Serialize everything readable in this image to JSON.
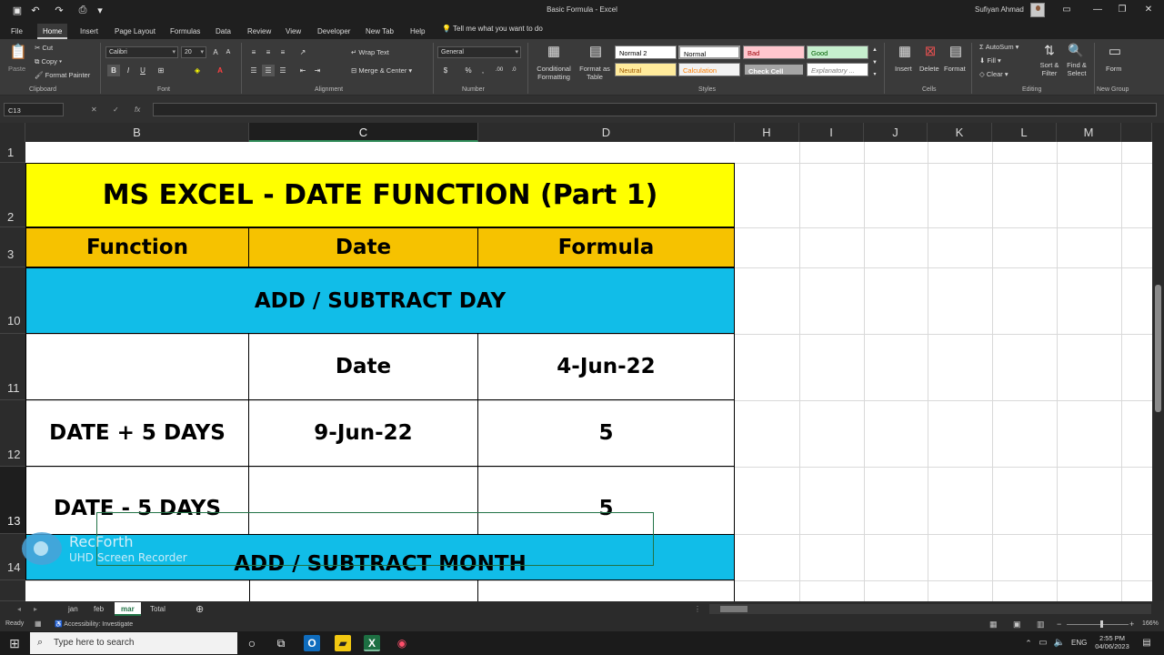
{
  "window": {
    "title": "Basic Formula  -  Excel",
    "user": "Sufiyan Ahmad"
  },
  "ribbon_tabs": [
    "File",
    "Home",
    "Insert",
    "Page Layout",
    "Formulas",
    "Data",
    "Review",
    "Developer",
    "New Tab",
    "Help"
  ],
  "tell_me": "Tell me what you want to do",
  "ribbon": {
    "clipboard": {
      "label": "Clipboard",
      "paste": "Paste",
      "cut": "Cut",
      "copy": "Copy",
      "format_painter": "Format Painter"
    },
    "font": {
      "label": "Font",
      "name": "Calibri",
      "size": "20"
    },
    "alignment": {
      "label": "Alignment",
      "wrap": "Wrap Text",
      "merge": "Merge & Center"
    },
    "number": {
      "label": "Number",
      "format": "General"
    },
    "styles": {
      "label": "Styles",
      "conditional": "Conditional Formatting",
      "format_as_table": "Format as Table",
      "cells": [
        {
          "name": "Normal 2",
          "bg": "#ffffff",
          "fg": "#000000"
        },
        {
          "name": "Normal",
          "bg": "#ffffff",
          "fg": "#000000"
        },
        {
          "name": "Bad",
          "bg": "#ffc7ce",
          "fg": "#9c0006"
        },
        {
          "name": "Good",
          "bg": "#c6efce",
          "fg": "#006100"
        },
        {
          "name": "Neutral",
          "bg": "#ffeb9c",
          "fg": "#9c5700"
        },
        {
          "name": "Calculation",
          "bg": "#f2f2f2",
          "fg": "#fa7d00"
        },
        {
          "name": "Check Cell",
          "bg": "#a5a5a5",
          "fg": "#ffffff"
        },
        {
          "name": "Explanatory ...",
          "bg": "#ffffff",
          "fg": "#7f7f7f"
        }
      ]
    },
    "cells_group": {
      "label": "Cells",
      "insert": "Insert",
      "delete": "Delete",
      "format": "Format"
    },
    "editing": {
      "label": "Editing",
      "autosum": "AutoSum",
      "fill": "Fill",
      "clear": "Clear",
      "sort": "Sort & Filter",
      "find": "Find & Select"
    },
    "new_group": {
      "label": "New Group",
      "form": "Form"
    }
  },
  "name_box": "C13",
  "columns": [
    "B",
    "C",
    "D",
    "H",
    "I",
    "J",
    "K",
    "L",
    "M"
  ],
  "rows": [
    "1",
    "2",
    "3",
    "10",
    "11",
    "12",
    "13",
    "14"
  ],
  "sheet": {
    "title": "MS EXCEL - DATE FUNCTION (Part 1)",
    "headers": [
      "Function",
      "Date",
      "Formula"
    ],
    "section1": "ADD / SUBTRACT DAY",
    "r11": [
      "",
      "Date",
      "4-Jun-22"
    ],
    "r12": [
      "DATE + 5 DAYS",
      "9-Jun-22",
      "5"
    ],
    "r13": [
      "DATE - 5 DAYS",
      "",
      "5"
    ],
    "section2": "ADD / SUBTRACT MONTH",
    "colors": {
      "title_bg": "#ffff00",
      "header_bg": "#f6c200",
      "section_bg": "#11bde8"
    }
  },
  "sheet_tabs": [
    "jan",
    "feb",
    "mar",
    "Total"
  ],
  "active_sheet": "mar",
  "status": {
    "ready": "Ready",
    "accessibility": "Accessibility: Investigate",
    "zoom": "166%"
  },
  "taskbar": {
    "search_placeholder": "Type here to search",
    "time": "2:55 PM",
    "date": "04/06/2023",
    "lang": "ENG"
  },
  "watermark": {
    "title": "RecForth",
    "subtitle": "UHD Screen Recorder"
  }
}
